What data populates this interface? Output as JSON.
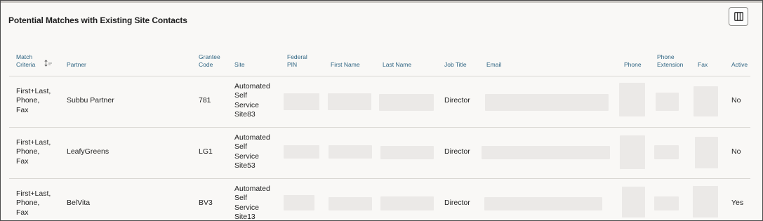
{
  "panel": {
    "title": "Potential Matches with Existing Site Contacts",
    "columns_button_icon": "columns-icon",
    "sort_icon": "sort-arrows-icon"
  },
  "columns": {
    "match_criteria": [
      "Match",
      "Criteria"
    ],
    "partner": "Partner",
    "grantee_code": [
      "Grantee",
      "Code"
    ],
    "site": "Site",
    "federal_pin": [
      "Federal",
      "PIN"
    ],
    "first_name": "First Name",
    "last_name": "Last Name",
    "job_title": "Job Title",
    "email": "Email",
    "phone": "Phone",
    "phone_extension": [
      "Phone",
      "Extension"
    ],
    "fax": "Fax",
    "active": "Active"
  },
  "rows": [
    {
      "match_criteria": [
        "First+Last,",
        "Phone,",
        "Fax"
      ],
      "partner": "Subbu Partner",
      "grantee_code": "781",
      "site": [
        "Automated",
        "Self",
        "Service",
        "Site83"
      ],
      "job_title": "Director",
      "active": "No"
    },
    {
      "match_criteria": [
        "First+Last,",
        "Phone,",
        "Fax"
      ],
      "partner": "LeafyGreens",
      "grantee_code": "LG1",
      "site": [
        "Automated",
        "Self",
        "Service",
        "Site53"
      ],
      "job_title": "Director",
      "active": "No"
    },
    {
      "match_criteria": [
        "First+Last,",
        "Phone,",
        "Fax"
      ],
      "partner": "BelVita",
      "grantee_code": "BV3",
      "site": [
        "Automated",
        "Self",
        "Service",
        "Site13"
      ],
      "job_title": "Director",
      "active": "Yes"
    }
  ],
  "colors": {
    "header_text": "#2f6583",
    "body_text": "#1e1e1e",
    "redacted_block": "#ebe9e7",
    "background": "#f9f8f6"
  }
}
